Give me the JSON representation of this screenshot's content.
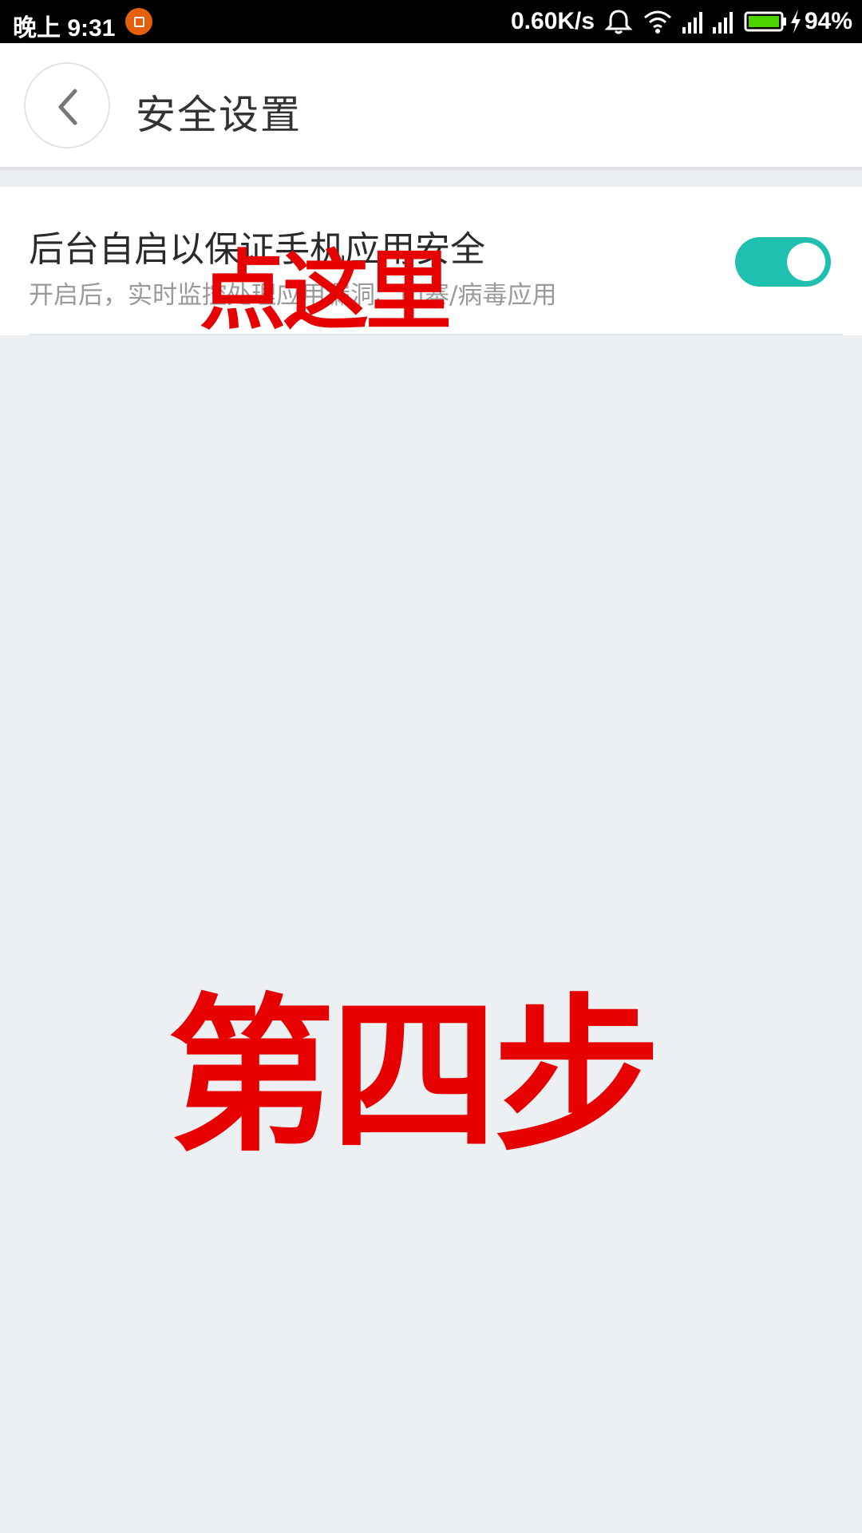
{
  "status_bar": {
    "time": "晚上 9:31",
    "network_speed": "0.60K/s",
    "battery": "94%",
    "icons": [
      "app-notification-icon",
      "alarm-bell-icon",
      "wifi-icon",
      "signal-1-icon",
      "signal-2-icon",
      "battery-icon",
      "charging-icon"
    ]
  },
  "header": {
    "back_icon": "chevron-left-icon",
    "title": "安全设置"
  },
  "setting": {
    "title": "后台自启以保证手机应用安全",
    "summary": "开启后，实时监控处理应用漏洞、山寨/病毒应用",
    "toggle_on": true
  },
  "overlay": {
    "tap_hint": "点这里",
    "step_label": "第四步"
  },
  "colors": {
    "accent": "#1fc0b0",
    "annotation": "#e60000",
    "background": "#edf0f2"
  }
}
